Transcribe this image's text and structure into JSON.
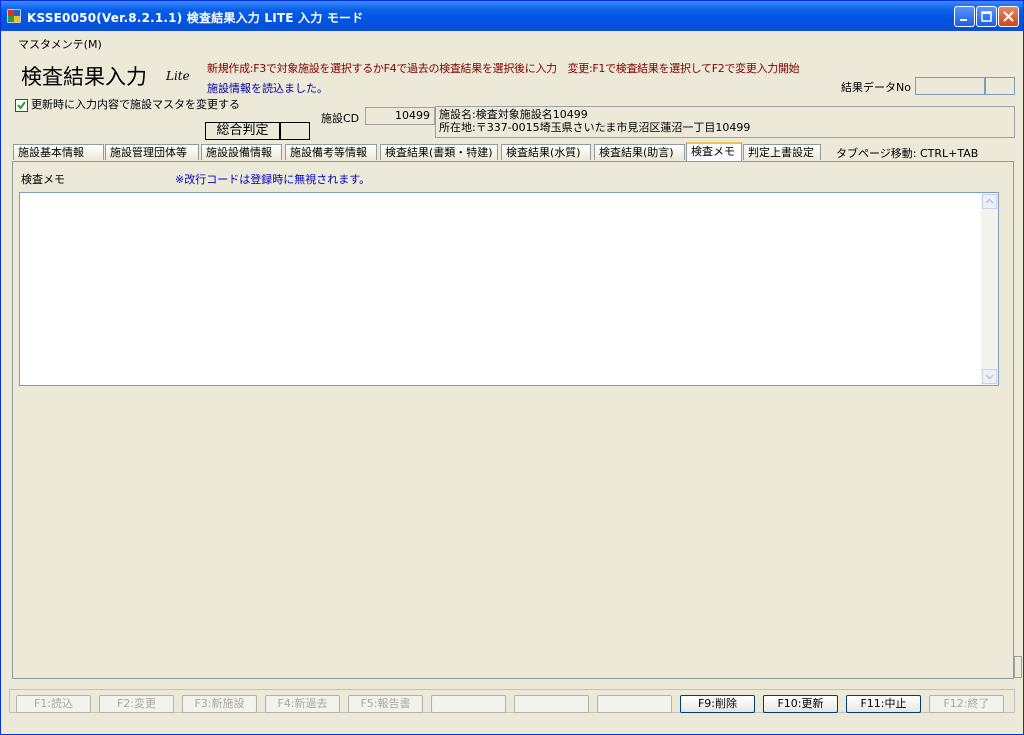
{
  "window": {
    "title": "KSSE0050(Ver.8.2.1.1) 検査結果入力 LITE 入力 モード"
  },
  "menu": {
    "items": [
      {
        "label": "マスタメンテ(M)"
      }
    ]
  },
  "header": {
    "title": "検査結果入力",
    "lite": "Lite",
    "hint": "新規作成:F3で対象施設を選択するかF4で過去の検査結果を選択後に入力　変更:F1で検査結果を選択してF2で変更入力開始",
    "status": "施設情報を読込ました。",
    "result_no_label": "結果データNo",
    "result_no_value": "",
    "result_no_suffix": ""
  },
  "options": {
    "update_master_label": "更新時に入力内容で施設マスタを変更する",
    "update_master_checked": true
  },
  "judgement": {
    "label": "総合判定",
    "value": ""
  },
  "facility": {
    "cd_label": "施設CD",
    "cd_value": "10499",
    "name_line": "施設名:検査対象施設名10499",
    "address_line": "所在地:〒337-0015埼玉県さいたま市見沼区蓮沼一丁目10499"
  },
  "tabs": [
    {
      "label": "施設基本情報"
    },
    {
      "label": "施設管理団体等"
    },
    {
      "label": "施設設備情報"
    },
    {
      "label": "施設備考等情報"
    },
    {
      "label": "検査結果(書類・特建)"
    },
    {
      "label": "検査結果(水質)"
    },
    {
      "label": "検査結果(助言)"
    },
    {
      "label": "検査メモ"
    },
    {
      "label": "判定上書設定"
    }
  ],
  "active_tab": 7,
  "tab_shortcut": "タブページ移動: CTRL+TAB",
  "memo": {
    "label": "検査メモ",
    "note": "※改行コードは登録時に無視されます。",
    "value": ""
  },
  "function_keys": [
    {
      "label": "F1:読込",
      "enabled": false
    },
    {
      "label": "F2:変更",
      "enabled": false
    },
    {
      "label": "F3:新施設",
      "enabled": false
    },
    {
      "label": "F4:新過去",
      "enabled": false
    },
    {
      "label": "F5:報告書",
      "enabled": false
    },
    {
      "label": "",
      "enabled": false
    },
    {
      "label": "",
      "enabled": false
    },
    {
      "label": "",
      "enabled": false
    },
    {
      "label": "F9:削除",
      "enabled": true
    },
    {
      "label": "F10:更新",
      "enabled": true
    },
    {
      "label": "F11:中止",
      "enabled": true
    },
    {
      "label": "F12:終了",
      "enabled": false
    }
  ],
  "colors": {
    "titlebar": "#0054e3",
    "hint": "#800000",
    "status": "#0000a0",
    "active_tab_accent": "#f5c24a"
  }
}
